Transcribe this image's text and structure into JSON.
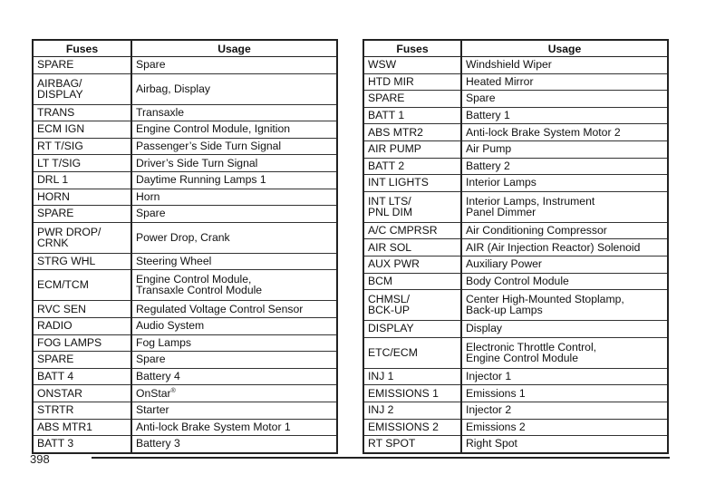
{
  "tables": [
    {
      "headers": {
        "fuse": "Fuses",
        "usage": "Usage"
      },
      "rows": [
        {
          "fuse": "SPARE",
          "usage": "Spare"
        },
        {
          "fuse": "AIRBAG/\nDISPLAY",
          "usage": "Airbag, Display"
        },
        {
          "fuse": "TRANS",
          "usage": "Transaxle"
        },
        {
          "fuse": "ECM IGN",
          "usage": "Engine Control Module, Ignition"
        },
        {
          "fuse": "RT T/SIG",
          "usage": "Passenger’s Side Turn Signal"
        },
        {
          "fuse": "LT T/SIG",
          "usage": "Driver’s Side Turn Signal"
        },
        {
          "fuse": "DRL 1",
          "usage": "Daytime Running Lamps 1"
        },
        {
          "fuse": "HORN",
          "usage": "Horn"
        },
        {
          "fuse": "SPARE",
          "usage": "Spare"
        },
        {
          "fuse": "PWR DROP/\nCRNK",
          "usage": "Power Drop, Crank"
        },
        {
          "fuse": "STRG WHL",
          "usage": "Steering Wheel"
        },
        {
          "fuse": "ECM/TCM",
          "usage": "Engine Control Module,\nTransaxle Control Module"
        },
        {
          "fuse": "RVC SEN",
          "usage": "Regulated Voltage Control Sensor"
        },
        {
          "fuse": "RADIO",
          "usage": "Audio System"
        },
        {
          "fuse": "FOG LAMPS",
          "usage": "Fog Lamps"
        },
        {
          "fuse": "SPARE",
          "usage": "Spare"
        },
        {
          "fuse": "BATT 4",
          "usage": "Battery 4"
        },
        {
          "fuse": "ONSTAR",
          "usage": "OnStar",
          "usage_sup": "®"
        },
        {
          "fuse": "STRTR",
          "usage": "Starter"
        },
        {
          "fuse": "ABS MTR1",
          "usage": "Anti-lock Brake System Motor 1"
        },
        {
          "fuse": "BATT 3",
          "usage": "Battery 3"
        }
      ]
    },
    {
      "headers": {
        "fuse": "Fuses",
        "usage": "Usage"
      },
      "rows": [
        {
          "fuse": "WSW",
          "usage": "Windshield Wiper"
        },
        {
          "fuse": "HTD MIR",
          "usage": "Heated Mirror"
        },
        {
          "fuse": "SPARE",
          "usage": "Spare"
        },
        {
          "fuse": "BATT 1",
          "usage": "Battery 1"
        },
        {
          "fuse": "ABS MTR2",
          "usage": "Anti-lock Brake System Motor 2"
        },
        {
          "fuse": "AIR PUMP",
          "usage": "Air Pump"
        },
        {
          "fuse": "BATT 2",
          "usage": "Battery 2"
        },
        {
          "fuse": "INT LIGHTS",
          "usage": "Interior Lamps"
        },
        {
          "fuse": "INT LTS/\nPNL DIM",
          "usage": "Interior Lamps, Instrument\nPanel Dimmer"
        },
        {
          "fuse": "A/C CMPRSR",
          "usage": "Air Conditioning Compressor"
        },
        {
          "fuse": "AIR SOL",
          "usage": "AIR (Air Injection Reactor) Solenoid"
        },
        {
          "fuse": "AUX PWR",
          "usage": "Auxiliary Power"
        },
        {
          "fuse": "BCM",
          "usage": "Body Control Module"
        },
        {
          "fuse": "CHMSL/\nBCK-UP",
          "usage": "Center High-Mounted Stoplamp,\nBack-up Lamps"
        },
        {
          "fuse": "DISPLAY",
          "usage": "Display"
        },
        {
          "fuse": "ETC/ECM",
          "usage": "Electronic Throttle Control,\nEngine Control Module"
        },
        {
          "fuse": "INJ 1",
          "usage": "Injector 1"
        },
        {
          "fuse": "EMISSIONS 1",
          "usage": "Emissions 1"
        },
        {
          "fuse": "INJ 2",
          "usage": "Injector 2"
        },
        {
          "fuse": "EMISSIONS 2",
          "usage": "Emissions 2"
        },
        {
          "fuse": "RT SPOT",
          "usage": "Right Spot"
        }
      ]
    }
  ],
  "footer": {
    "page_number": "398"
  }
}
